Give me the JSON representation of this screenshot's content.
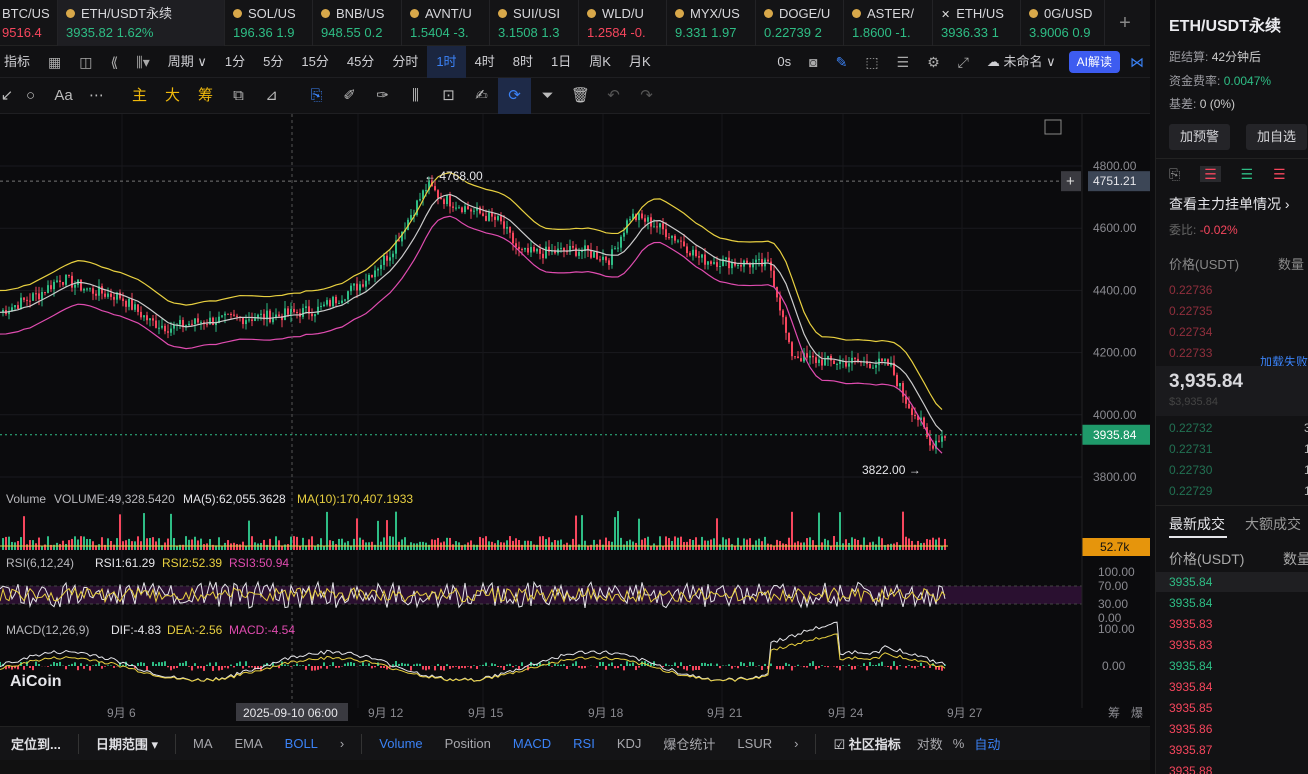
{
  "tabs": [
    {
      "symbol": "BTC/US",
      "price": "9516.4",
      "change": "",
      "dir": "down",
      "partial": true
    },
    {
      "symbol": "ETH/USDT永续",
      "price": "3935.82",
      "change": "1.62%",
      "dir": "up",
      "active": true
    },
    {
      "symbol": "SOL/US",
      "price": "196.36",
      "change": "1.9",
      "dir": "up"
    },
    {
      "symbol": "BNB/US",
      "price": "948.55",
      "change": "0.2",
      "dir": "up"
    },
    {
      "symbol": "AVNT/U",
      "price": "1.5404",
      "change": "-3.",
      "dir": "up"
    },
    {
      "symbol": "SUI/USI",
      "price": "3.1508",
      "change": "1.3",
      "dir": "up"
    },
    {
      "symbol": "WLD/U",
      "price": "1.2584",
      "change": "-0.",
      "dir": "down"
    },
    {
      "symbol": "MYX/US",
      "price": "9.331",
      "change": "1.97",
      "dir": "up"
    },
    {
      "symbol": "DOGE/U",
      "price": "0.22739",
      "change": "2",
      "dir": "up"
    },
    {
      "symbol": "ASTER/",
      "price": "1.8600",
      "change": "-1.",
      "dir": "up"
    },
    {
      "symbol": "ETH/US",
      "price": "3936.33",
      "change": "1",
      "dir": "up"
    },
    {
      "symbol": "0G/USD",
      "price": "3.9006",
      "change": "0.9",
      "dir": "up"
    }
  ],
  "toolbar1": {
    "indicators": "指标",
    "period": "周期",
    "intervals": [
      "1分",
      "5分",
      "15分",
      "45分",
      "分时",
      "1时",
      "4时",
      "8时",
      "1日",
      "周K",
      "月K"
    ],
    "selected_interval": "1时",
    "zero_s": "0s",
    "layout_name": "未命名",
    "ai": "AI解读"
  },
  "toolbar2": {
    "text_tool": "Aa",
    "main": "主",
    "big": "大",
    "chips": "筹"
  },
  "chart": {
    "price_ticks": [
      "4800.00",
      "4600.00",
      "4400.00",
      "4200.00",
      "4000.00",
      "3800.00"
    ],
    "current_price": "3935.84",
    "crosshair_price": "4751.21",
    "high_label": "4768.00",
    "low_label": "3822.00",
    "date_ticks": [
      "9月 6",
      "9月 12",
      "9月 15",
      "9月 18",
      "9月 21",
      "9月 24",
      "9月 27"
    ],
    "crosshair_date": "2025-09-10 06:00",
    "volume_label": "Volume",
    "volume_value": "VOLUME:49,328.5420",
    "vol_ma5": "MA(5):62,055.3628",
    "vol_ma10": "MA(10):170,407.1933",
    "volume_tag": "52.7k",
    "rsi_label": "RSI(6,12,24)",
    "rsi1": "RSI1:61.29",
    "rsi2": "RSI2:52.39",
    "rsi3": "RSI3:50.94",
    "rsi_ticks": [
      "100.00",
      "70.00",
      "30.00",
      "0.00"
    ],
    "macd_label": "MACD(12,26,9)",
    "dif": "DIF:-4.83",
    "dea": "DEA:-2.56",
    "macd": "MACD:-4.54",
    "macd_ticks": [
      "100.00",
      "0.00"
    ],
    "brand": "AiCoin",
    "right_axis_labels": [
      "筹",
      "爆"
    ]
  },
  "bottom": {
    "locate": "定位到...",
    "date_range": "日期范围",
    "items": [
      "MA",
      "EMA",
      "BOLL",
      "Volume",
      "Position",
      "MACD",
      "RSI",
      "KDJ",
      "爆仓统计",
      "LSUR"
    ],
    "community": "社区指标",
    "log": "对数",
    "pct": "%",
    "auto": "自动"
  },
  "right_panel": {
    "title": "ETH/USDT永续",
    "settle_label": "距结算:",
    "settle_value": "42分钟后",
    "funding_label": "资金费率:",
    "funding_value": "0.0047%",
    "basis_label": "基差:",
    "basis_value": "0 (0%)",
    "alert_btn": "加预警",
    "watch_btn": "加自选",
    "orderbook_link": "查看主力挂单情况",
    "ratio_label": "委比:",
    "ratio_value": "-0.02%",
    "price_header": "价格(USDT)",
    "qty_header": "数量",
    "asks": [
      "0.22736",
      "0.22735",
      "0.22734",
      "0.22733"
    ],
    "load_fail": "加载失败",
    "last_price": "3,935.84",
    "last_usd": "$3,935.84",
    "bids": [
      "0.22732",
      "0.22731",
      "0.22730",
      "0.22729"
    ],
    "bid_qty": "3",
    "trades_tab": "最新成交",
    "big_trades_tab": "大额成交",
    "trades": [
      {
        "p": "3935.84",
        "d": "up"
      },
      {
        "p": "3935.84",
        "d": "up"
      },
      {
        "p": "3935.83",
        "d": "down"
      },
      {
        "p": "3935.83",
        "d": "down"
      },
      {
        "p": "3935.84",
        "d": "up"
      },
      {
        "p": "3935.84",
        "d": "down"
      },
      {
        "p": "3935.85",
        "d": "down"
      },
      {
        "p": "3935.86",
        "d": "down"
      },
      {
        "p": "3935.87",
        "d": "down"
      },
      {
        "p": "3935.88",
        "d": "down"
      }
    ],
    "colors": {
      "up": "#2ebd85",
      "down": "#f6465d",
      "accent": "#3b82f6"
    }
  }
}
